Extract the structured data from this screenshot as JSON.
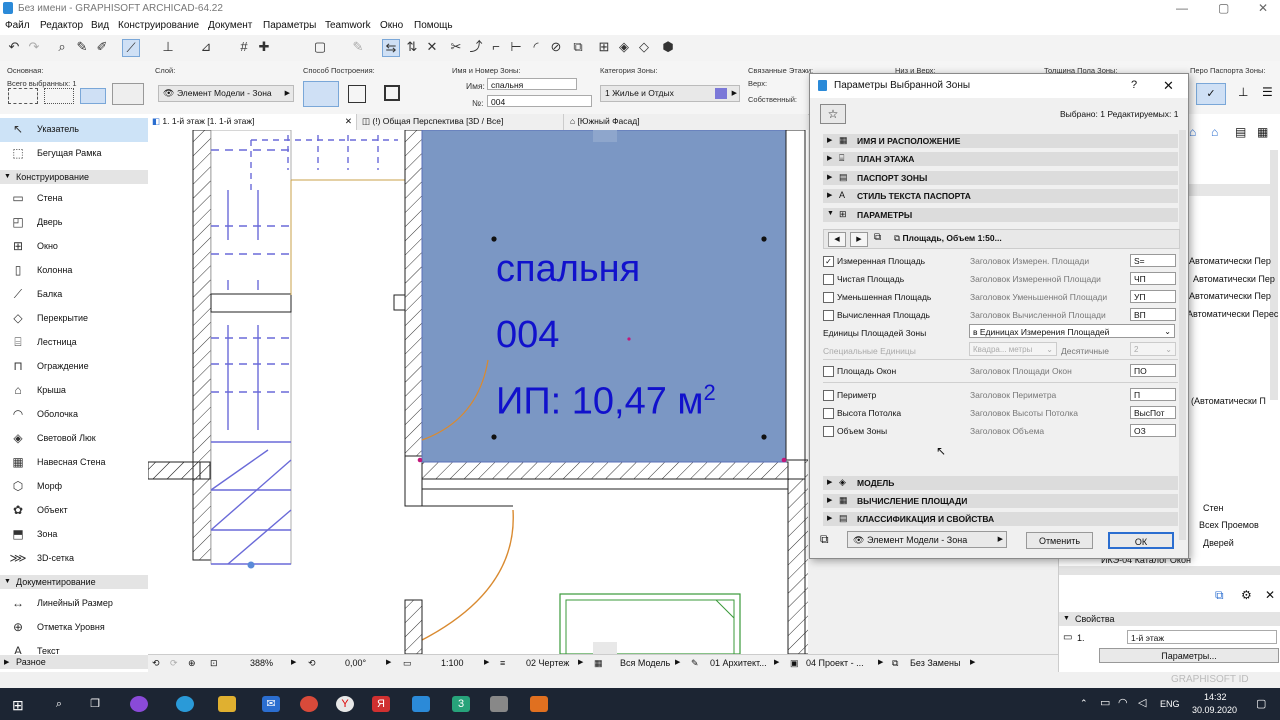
{
  "window": {
    "title": "Без имени - GRAPHISOFT ARCHICAD-64.22",
    "controls": [
      "—",
      "▢",
      "✕"
    ]
  },
  "menu": [
    "Файл",
    "Редактор",
    "Вид",
    "Конструирование",
    "Документ",
    "Параметры",
    "Teamwork",
    "Окно",
    "Помощь"
  ],
  "infobox": {
    "osnovnaya_label": "Основная:",
    "vsego_vybrannyh": "Всего выбранных: 1",
    "sloy_label": "Слой:",
    "sloy_value": "Элемент Модели - Зона",
    "sposob_label": "Способ Построения:",
    "imya_nomer_label": "Имя и Номер Зоны:",
    "imya_label": "Имя:",
    "imya_value": "спальня",
    "nomer_label": "№:",
    "nomer_value": "004",
    "kategoriya_label": "Категория Зоны:",
    "kategoriya_value": "1  Жилье и Отдых",
    "kategoriya_color": "#7b78d8",
    "svyazannye_label": "Связанные Этажи:",
    "verh_label": "Верх:",
    "sobstvenny_label": "Собственный:",
    "niz_label": "Низ и Верх:",
    "tolshina_label": "Толщина Пола Зоны:",
    "pero_label": "Перо Паспорта Зоны:"
  },
  "toolbox": {
    "items": [
      {
        "name": "Указатель",
        "icon": "↖"
      },
      {
        "name": "Бегущая Рамка",
        "icon": "⬚"
      }
    ],
    "section_konstr": "Конструирование",
    "konstr": [
      {
        "name": "Стена",
        "icon": "▭"
      },
      {
        "name": "Дверь",
        "icon": "◰"
      },
      {
        "name": "Окно",
        "icon": "⊞"
      },
      {
        "name": "Колонна",
        "icon": "▯"
      },
      {
        "name": "Балка",
        "icon": "⟋"
      },
      {
        "name": "Перекрытие",
        "icon": "◇"
      },
      {
        "name": "Лестница",
        "icon": "⌸"
      },
      {
        "name": "Ограждение",
        "icon": "⊓"
      },
      {
        "name": "Крыша",
        "icon": "⌂"
      },
      {
        "name": "Оболочка",
        "icon": "◠"
      },
      {
        "name": "Световой Люк",
        "icon": "◈"
      },
      {
        "name": "Навесная Стена",
        "icon": "▦"
      },
      {
        "name": "Морф",
        "icon": "⬡"
      },
      {
        "name": "Объект",
        "icon": "✿"
      },
      {
        "name": "Зона",
        "icon": "⬒"
      },
      {
        "name": "3D-сетка",
        "icon": "⋙"
      }
    ],
    "section_doc": "Документирование",
    "doc": [
      {
        "name": "Линейный Размер",
        "icon": "↔"
      },
      {
        "name": "Отметка Уровня",
        "icon": "⊕"
      },
      {
        "name": "Текст",
        "icon": "A"
      }
    ],
    "section_raznoe": "Разное"
  },
  "tabs": [
    {
      "label": "1. 1-й этаж [1. 1-й этаж]"
    },
    {
      "label": "(!) Общая Перспектива [3D / Все]"
    },
    {
      "label": "[Южный Фасад]"
    }
  ],
  "zone": {
    "name": "спальня",
    "number": "004",
    "area_text": "ИП: 10,47 м",
    "area_sup": "2",
    "fill_color": "#7b97c4",
    "text_color": "#1111cc"
  },
  "statusbar": {
    "zoom": "388%",
    "angle": "0,00°",
    "scale": "1:100",
    "layer_combo": "02 Чертеж",
    "model_view": "Вся Модель",
    "pen_set": "01 Архитект...",
    "graphic_override": "04 Проект - ...",
    "renovation": "Без Замены"
  },
  "rightpanel": {
    "lines": [
      "Автоматически Пер",
      "Автоматически Пер",
      "Автоматически Пер",
      "Автоматически Перес",
      "(Автоматически П",
      "Стен",
      "Всех Проемов",
      "Дверей",
      "ИКЭ-04 Каталог Окон"
    ],
    "svoystva_label": "Свойства",
    "storey_num": "1.",
    "storey_name": "1-й этаж",
    "params_button": "Параметры...",
    "watermark": "GRAPHISOFT ID"
  },
  "dialog": {
    "title": "Параметры Выбранной Зоны",
    "help": "?",
    "close": "✕",
    "selected": "Выбрано: 1 Редактируемых: 1",
    "panels_top": [
      "ИМЯ И РАСПОЛОЖЕНИЕ",
      "ПЛАН ЭТАЖА",
      "ПАСПОРТ ЗОНЫ",
      "СТИЛЬ ТЕКСТА ПАСПОРТА",
      "ПАРАМЕТРЫ"
    ],
    "preset": "Площадь, Объем 1:50...",
    "rows": [
      {
        "label": "Измеренная Площадь",
        "checked": true,
        "hdr": "Заголовок Измерен. Площади",
        "value": "S="
      },
      {
        "label": "Чистая Площадь",
        "checked": false,
        "hdr": "Заголовок Измеренной Площади",
        "value": "ЧП"
      },
      {
        "label": "Уменьшенная Площадь",
        "checked": false,
        "hdr": "Заголовок Уменьшенной Площади",
        "value": "УП"
      },
      {
        "label": "Вычисленная Площадь",
        "checked": false,
        "hdr": "Заголовок Вычисленной Площади",
        "value": "ВП"
      }
    ],
    "units_label": "Единицы Площадей Зоны",
    "units_value": "в Единицах Измерения Площадей",
    "special_units_label": "Специальные Единицы",
    "special_units_value": "Квадра... метры",
    "decimals_label": "Десятичные",
    "decimals_value": "2",
    "rows2": [
      {
        "label": "Площадь Окон",
        "checked": false,
        "hdr": "Заголовок Площади Окон",
        "value": "ПО"
      }
    ],
    "rows3": [
      {
        "label": "Периметр",
        "checked": false,
        "hdr": "Заголовок Периметра",
        "value": "П"
      },
      {
        "label": "Высота Потолка",
        "checked": false,
        "hdr": "Заголовок Высоты Потолка",
        "value": "ВысПот"
      },
      {
        "label": "Объем Зоны",
        "checked": false,
        "hdr": "Заголовок Объема",
        "value": "ОЗ"
      }
    ],
    "panels_bottom": [
      "МОДЕЛЬ",
      "ВЫЧИСЛЕНИЕ ПЛОЩАДИ",
      "КЛАССИФИКАЦИЯ И СВОЙСТВА"
    ],
    "layer_value": "Элемент Модели - Зона",
    "cancel": "Отменить",
    "ok": "ОК"
  },
  "taskbar": {
    "lang": "ENG",
    "time": "14:32",
    "date": "30.09.2020"
  }
}
